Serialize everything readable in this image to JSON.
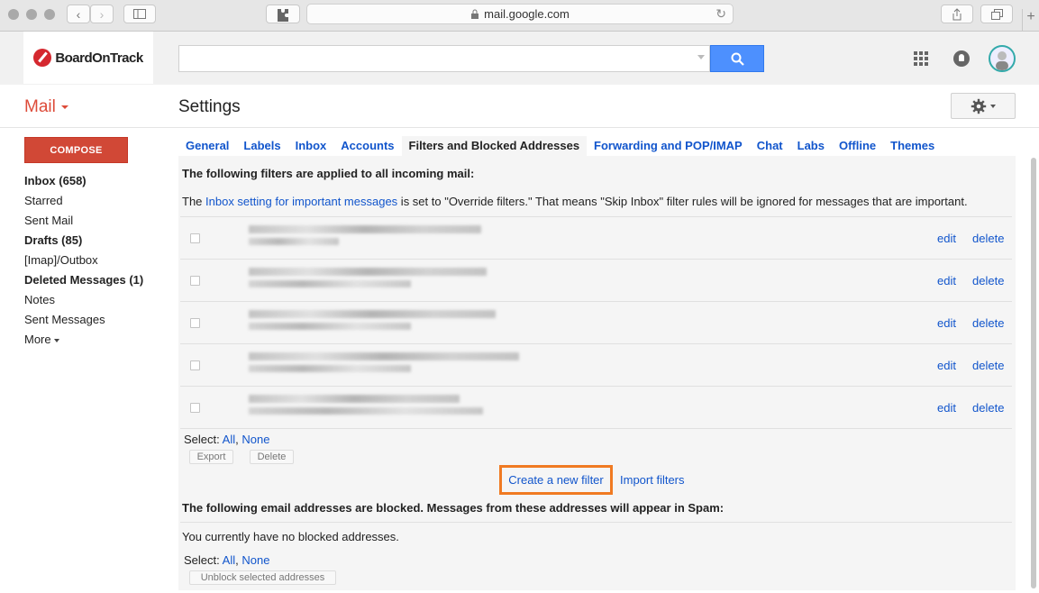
{
  "browser": {
    "url": "mail.google.com"
  },
  "brand": {
    "name": "BoardOnTrack"
  },
  "header": {
    "search_placeholder": ""
  },
  "app": {
    "mail_label": "Mail",
    "page_title": "Settings"
  },
  "compose_label": "COMPOSE",
  "nav": [
    {
      "label": "Inbox (658)",
      "bold": true
    },
    {
      "label": "Starred",
      "bold": false
    },
    {
      "label": "Sent Mail",
      "bold": false
    },
    {
      "label": "Drafts (85)",
      "bold": true
    },
    {
      "label": "[Imap]/Outbox",
      "bold": false
    },
    {
      "label": "Deleted Messages (1)",
      "bold": true
    },
    {
      "label": "Notes",
      "bold": false
    },
    {
      "label": "Sent Messages",
      "bold": false
    }
  ],
  "nav_more": "More",
  "tabs": [
    "General",
    "Labels",
    "Inbox",
    "Accounts",
    "Filters and Blocked Addresses",
    "Forwarding and POP/IMAP",
    "Chat",
    "Labs",
    "Offline",
    "Themes"
  ],
  "active_tab": "Filters and Blocked Addresses",
  "filters": {
    "heading": "The following filters are applied to all incoming mail:",
    "note_prefix": "The ",
    "note_link": "Inbox setting for important messages",
    "note_suffix": " is set to \"Override filters.\" That means \"Skip Inbox\" filter rules will be ignored for messages that are important.",
    "edit_label": "edit",
    "delete_label": "delete",
    "rows": 5,
    "select_label": "Select:",
    "select_all": "All",
    "select_none": "None",
    "export_label": "Export",
    "delete_btn_label": "Delete",
    "create_label": "Create a new filter",
    "import_label": "Import filters"
  },
  "blocked": {
    "heading": "The following email addresses are blocked. Messages from these addresses will appear in Spam:",
    "empty_text": "You currently have no blocked addresses.",
    "select_label": "Select:",
    "select_all": "All",
    "select_none": "None",
    "unblock_label": "Unblock selected addresses"
  },
  "colors": {
    "accent": "#1155cc",
    "compose": "#d14836",
    "search": "#4d90fe",
    "highlight": "#f07a22"
  }
}
